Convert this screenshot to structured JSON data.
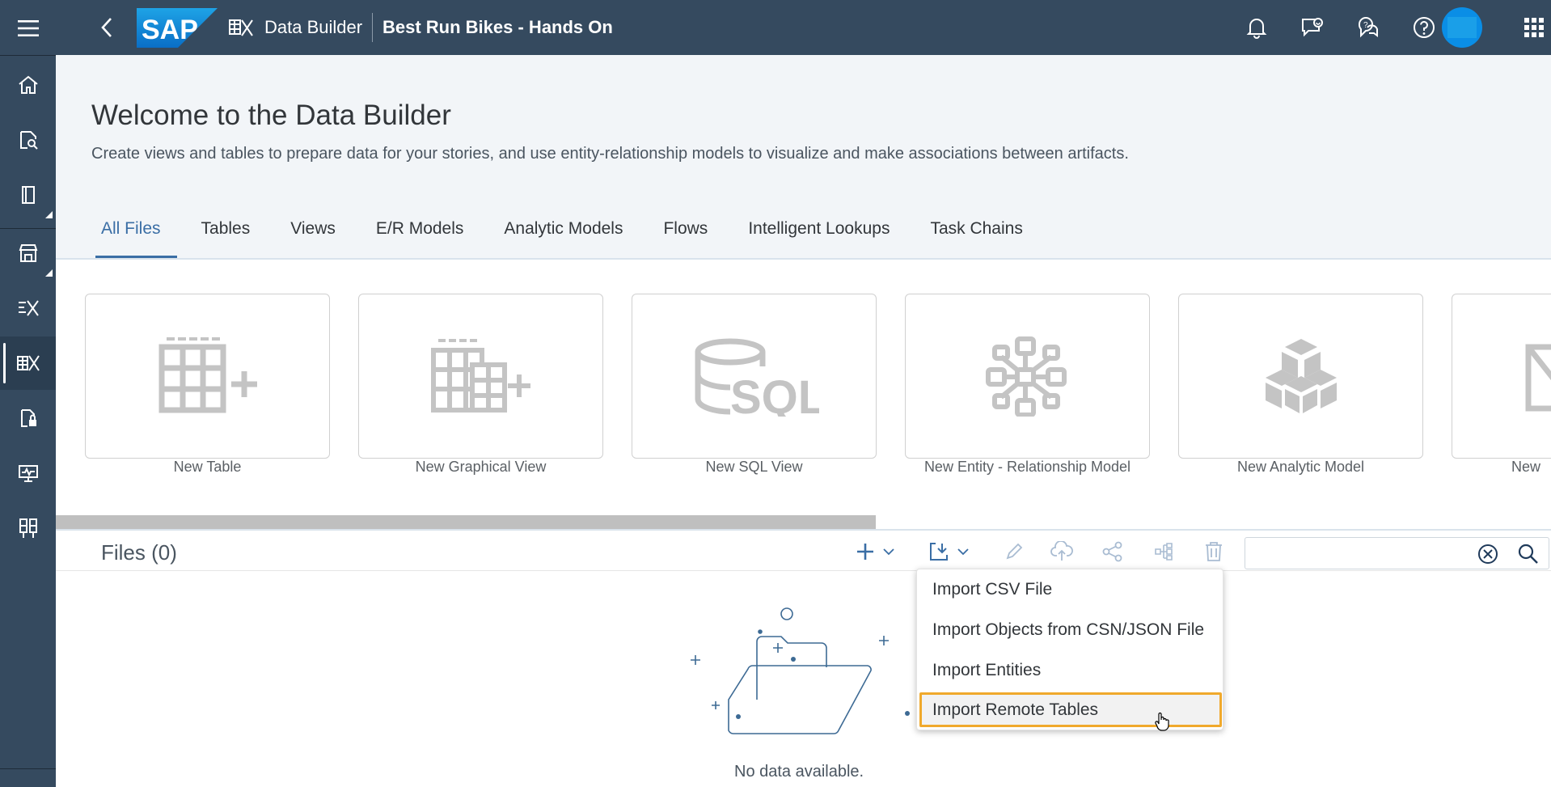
{
  "shell": {
    "app_title": "Data Builder",
    "space_title": "Best Run Bikes - Hands On",
    "logo_text": "SAP"
  },
  "rail": {
    "items": [
      "menu-icon",
      "home-icon",
      "repository-explorer-icon",
      "catalog-icon",
      "data-marketplace-icon",
      "business-builder-icon",
      "data-builder-icon",
      "data-access-control-icon",
      "data-integration-monitor-icon",
      "space-management-icon"
    ]
  },
  "header": {
    "title": "Welcome to the Data Builder",
    "subtitle": "Create views and tables to prepare data for your stories, and use entity-relationship models to visualize and make associations between artifacts."
  },
  "tabs": [
    {
      "label": "All Files"
    },
    {
      "label": "Tables"
    },
    {
      "label": "Views"
    },
    {
      "label": "E/R Models"
    },
    {
      "label": "Analytic Models"
    },
    {
      "label": "Flows"
    },
    {
      "label": "Intelligent Lookups"
    },
    {
      "label": "Task Chains"
    }
  ],
  "tiles": [
    {
      "label": "New Table",
      "icon": "new-table-icon"
    },
    {
      "label": "New Graphical View",
      "icon": "new-graphical-view-icon"
    },
    {
      "label": "New SQL View",
      "icon": "sql-icon"
    },
    {
      "label": "New Entity - Relationship Model",
      "icon": "er-model-icon"
    },
    {
      "label": "New Analytic Model",
      "icon": "analytic-model-icon"
    },
    {
      "label": "New",
      "icon": "new-flow-icon"
    }
  ],
  "files": {
    "title": "Files (0)",
    "empty_text": "No data available.",
    "search_placeholder": ""
  },
  "import_menu": {
    "items": [
      {
        "label": "Import CSV File"
      },
      {
        "label": "Import Objects from CSN/JSON File"
      },
      {
        "label": "Import Entities"
      },
      {
        "label": "Import Remote Tables"
      }
    ]
  },
  "colors": {
    "shell": "#354a5f",
    "accent": "#3a6ea5",
    "highlight": "#f0a92c"
  }
}
